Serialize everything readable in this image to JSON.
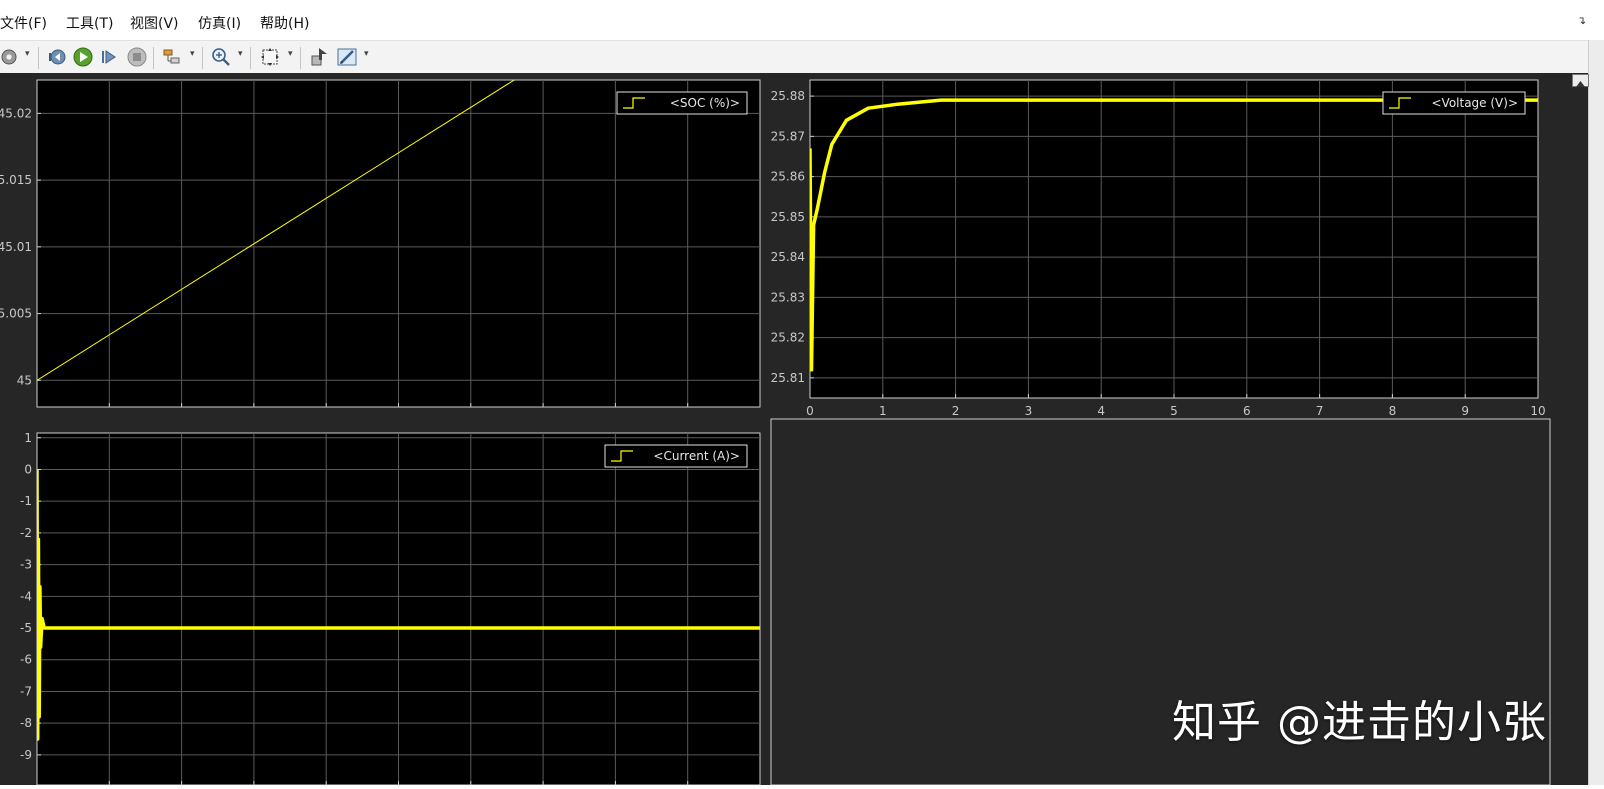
{
  "menu": [
    {
      "label": "文件(F)"
    },
    {
      "label": "工具(T)"
    },
    {
      "label": "视图(V)"
    },
    {
      "label": "仿真(I)"
    },
    {
      "label": "帮助(H)"
    }
  ],
  "toolbar": {
    "icons": [
      "gear-icon",
      "step-back-icon",
      "run-icon",
      "step-forward-icon",
      "stop-icon",
      "highlight-icon",
      "zoom-icon",
      "autoscale-icon",
      "write-data-icon",
      "style-icon"
    ]
  },
  "colors": {
    "signal": "#ffff00",
    "axes_bg": "#000000",
    "figure_bg": "#262626",
    "grid": "#5a5a5a",
    "tick_text": "#c8c8c8"
  },
  "watermark": "知乎 @进击的小张",
  "chart_data": [
    {
      "type": "line",
      "legend": "<SOC (%)>",
      "legend_position": "top-right",
      "grid": true,
      "ylim": [
        44.998,
        45.0225
      ],
      "yticks": [
        45,
        45.005,
        45.01,
        45.015,
        45.02
      ],
      "ytick_labels": [
        "45",
        "5.005",
        "45.01",
        "5.015",
        "45.02"
      ],
      "xlim": [
        0,
        10
      ],
      "series": [
        {
          "x": [
            0,
            6.6
          ],
          "y": [
            45.0,
            45.0225
          ]
        }
      ]
    },
    {
      "type": "line",
      "legend": "<Voltage (V)>",
      "legend_position": "top-right",
      "grid": true,
      "ylim": [
        25.805,
        25.884
      ],
      "yticks": [
        25.81,
        25.82,
        25.83,
        25.84,
        25.85,
        25.86,
        25.87,
        25.88
      ],
      "ytick_labels": [
        "25.81",
        "25.82",
        "25.83",
        "25.84",
        "25.85",
        "25.86",
        "25.87",
        "25.88"
      ],
      "xlim": [
        0,
        10
      ],
      "xticks": [
        0,
        1,
        2,
        3,
        4,
        5,
        6,
        7,
        8,
        9,
        10
      ],
      "xtick_labels": [
        "0",
        "1",
        "2",
        "3",
        "4",
        "5",
        "6",
        "7",
        "8",
        "9",
        "10"
      ],
      "series": [
        {
          "x": [
            0,
            0.02,
            0.05,
            0.1,
            0.2,
            0.3,
            0.5,
            0.8,
            1.2,
            1.8,
            3,
            5,
            10
          ],
          "y": [
            25.867,
            25.812,
            25.848,
            25.852,
            25.861,
            25.868,
            25.874,
            25.877,
            25.878,
            25.879,
            25.879,
            25.879,
            25.879
          ]
        }
      ]
    },
    {
      "type": "line",
      "legend": "<Current (A)>",
      "legend_position": "top-right",
      "grid": true,
      "ylim": [
        -9.95,
        1.15
      ],
      "yticks": [
        1,
        0,
        -1,
        -2,
        -3,
        -4,
        -5,
        -6,
        -7,
        -8,
        -9
      ],
      "ytick_labels": [
        "1",
        "0",
        "-1",
        "-2",
        "-3",
        "-4",
        "-5",
        "-6",
        "-7",
        "-8",
        "-9"
      ],
      "xlim": [
        0,
        10
      ],
      "xticks": [
        0,
        1,
        2,
        3,
        4,
        5,
        6,
        7,
        8,
        9,
        10
      ],
      "xtick_labels": [
        "0",
        "1",
        "2",
        "3",
        "4",
        "5",
        "6",
        "7",
        "8",
        "9",
        "10"
      ],
      "series": [
        {
          "x": [
            0,
            0.01,
            0.02,
            0.03,
            0.04,
            0.05,
            0.07,
            0.1,
            0.15,
            10
          ],
          "y": [
            0,
            -8.5,
            -2.2,
            -7.8,
            -3.7,
            -5.6,
            -4.7,
            -5.0,
            -5.0,
            -5.0
          ]
        }
      ]
    }
  ]
}
